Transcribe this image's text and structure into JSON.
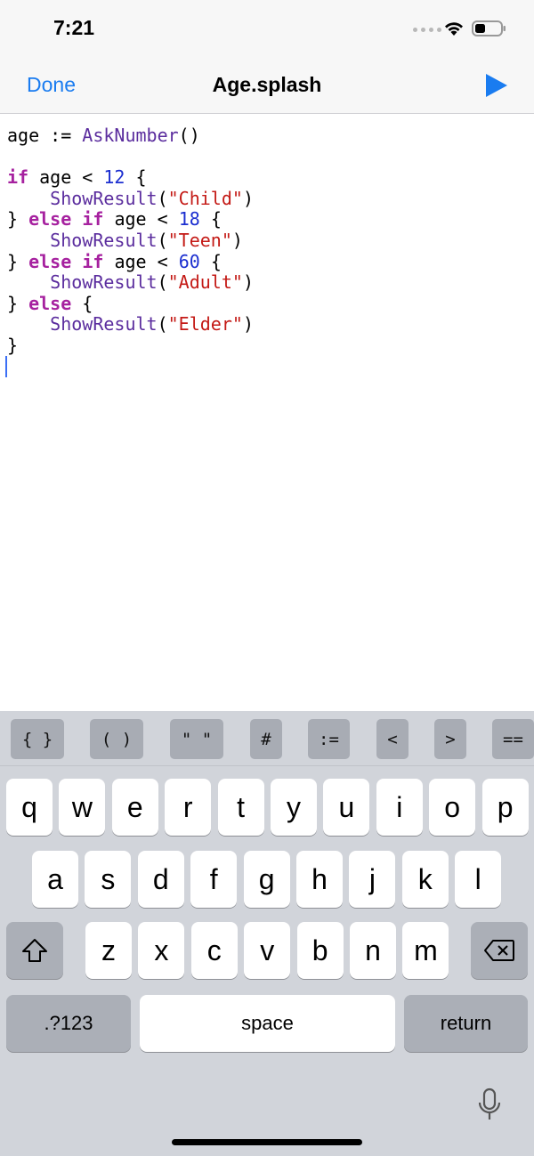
{
  "status_bar": {
    "time": "7:21"
  },
  "nav": {
    "done_label": "Done",
    "title": "Age.splash",
    "run_icon": "play-icon"
  },
  "code_lines": [
    [
      [
        "age := ",
        "plain"
      ],
      [
        "AskNumber",
        "fn"
      ],
      [
        "()",
        "plain"
      ]
    ],
    [],
    [
      [
        "if",
        "kw"
      ],
      [
        " age < ",
        "plain"
      ],
      [
        "12",
        "num"
      ],
      [
        " {",
        "plain"
      ]
    ],
    [
      [
        "    ",
        "plain"
      ],
      [
        "ShowResult",
        "fn"
      ],
      [
        "(",
        "plain"
      ],
      [
        "\"Child\"",
        "str"
      ],
      [
        ")",
        "plain"
      ]
    ],
    [
      [
        "} ",
        "plain"
      ],
      [
        "else",
        "kw"
      ],
      [
        " ",
        "plain"
      ],
      [
        "if",
        "kw"
      ],
      [
        " age < ",
        "plain"
      ],
      [
        "18",
        "num"
      ],
      [
        " {",
        "plain"
      ]
    ],
    [
      [
        "    ",
        "plain"
      ],
      [
        "ShowResult",
        "fn"
      ],
      [
        "(",
        "plain"
      ],
      [
        "\"Teen\"",
        "str"
      ],
      [
        ")",
        "plain"
      ]
    ],
    [
      [
        "} ",
        "plain"
      ],
      [
        "else",
        "kw"
      ],
      [
        " ",
        "plain"
      ],
      [
        "if",
        "kw"
      ],
      [
        " age < ",
        "plain"
      ],
      [
        "60",
        "num"
      ],
      [
        " {",
        "plain"
      ]
    ],
    [
      [
        "    ",
        "plain"
      ],
      [
        "ShowResult",
        "fn"
      ],
      [
        "(",
        "plain"
      ],
      [
        "\"Adult\"",
        "str"
      ],
      [
        ")",
        "plain"
      ]
    ],
    [
      [
        "} ",
        "plain"
      ],
      [
        "else",
        "kw"
      ],
      [
        " {",
        "plain"
      ]
    ],
    [
      [
        "    ",
        "plain"
      ],
      [
        "ShowResult",
        "fn"
      ],
      [
        "(",
        "plain"
      ],
      [
        "\"Elder\"",
        "str"
      ],
      [
        ")",
        "plain"
      ]
    ],
    [
      [
        "}",
        "plain"
      ]
    ]
  ],
  "accessory_keys": [
    "{ }",
    "( )",
    "\" \"",
    "#",
    ":=",
    "<",
    ">",
    "=="
  ],
  "keyboard": {
    "row1": [
      "q",
      "w",
      "e",
      "r",
      "t",
      "y",
      "u",
      "i",
      "o",
      "p"
    ],
    "row2": [
      "a",
      "s",
      "d",
      "f",
      "g",
      "h",
      "j",
      "k",
      "l"
    ],
    "row3": [
      "z",
      "x",
      "c",
      "v",
      "b",
      "n",
      "m"
    ],
    "numbers_label": ".?123",
    "space_label": "space",
    "return_label": "return"
  },
  "colors": {
    "accent": "#1a7cf0",
    "keyword": "#a6219f",
    "function": "#5b2d9e",
    "number": "#1c2fd0",
    "string": "#c41a16"
  }
}
